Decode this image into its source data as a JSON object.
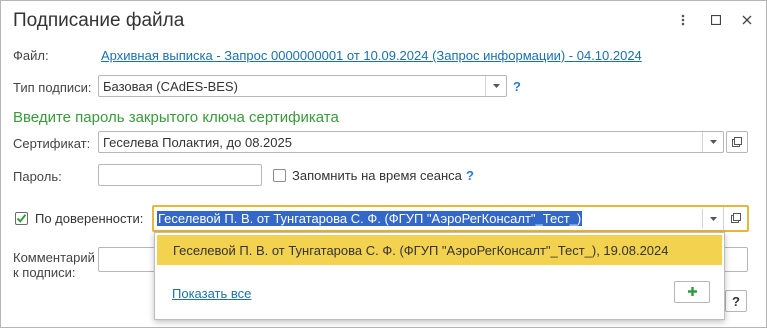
{
  "window": {
    "title": "Подписание файла",
    "controls": {
      "menu_icon": "more-vertical-icon",
      "maximize_icon": "maximize-icon",
      "close_icon": "close-icon"
    }
  },
  "form": {
    "file_label": "Файл:",
    "file_link": "Архивная выписка - Запрос 0000000001 от 10.09.2024 (Запрос информации) - 04.10.2024",
    "sign_type_label": "Тип подписи:",
    "sign_type_value": "Базовая (CAdES-BES)",
    "help_mark": "?",
    "password_heading": "Введите пароль закрытого ключа сертификата",
    "certificate_label": "Сертификат:",
    "certificate_value": "Геселева Полактия, до 08.2025",
    "password_label": "Пароль:",
    "password_value": "",
    "remember_label": "Запомнить на время сеанса",
    "remember_checked": false,
    "proxy_label": "По доверенности:",
    "proxy_checked": true,
    "proxy_value": "Геселевой П. В. от Тунгатарова С. Ф. (ФГУП \"АэроРегКонсалт\"_Тест_)",
    "comment_label_line1": "Комментарий",
    "comment_label_line2": "к подписи:",
    "comment_value": ""
  },
  "dropdown": {
    "items": [
      "Геселевой П. В. от Тунгатарова С. Ф. (ФГУП \"АэроРегКонсалт\"_Тест_), 19.08.2024"
    ],
    "show_all": "Показать все",
    "add_icon": "plus-icon"
  },
  "colors": {
    "accent_green": "#3a9a3a",
    "link_blue": "#1c6fb3",
    "highlight_yellow": "#f3d24f",
    "focus_border": "#e5b73b",
    "selection_blue": "#3367c8"
  }
}
